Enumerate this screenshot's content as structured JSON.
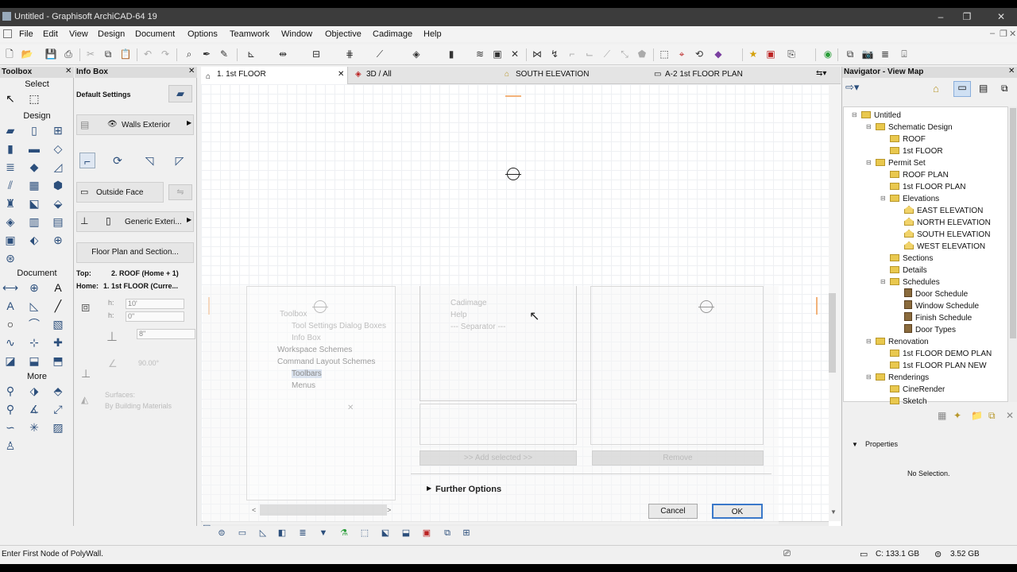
{
  "window": {
    "title": "Untitled - Graphisoft ArchiCAD-64 19"
  },
  "menu": [
    "File",
    "Edit",
    "View",
    "Design",
    "Document",
    "Options",
    "Teamwork",
    "Window",
    "Objective",
    "Cadimage",
    "Help"
  ],
  "toolbox": {
    "title": "Toolbox",
    "select_label": "Select",
    "design_label": "Design",
    "document_label": "Document",
    "more_label": "More"
  },
  "infobox": {
    "title": "Info Box",
    "default_settings": "Default Settings",
    "wall_type": "Walls Exterior",
    "reference_line": "Outside Face",
    "composite": "Generic Exteri...",
    "floor_plan_button": "Floor Plan and Section...",
    "top_label": "Top:",
    "top_value": "2. ROOF (Home + 1)",
    "home_label": "Home:",
    "home_value": "1. 1st FLOOR (Curre...",
    "height_label": "h:",
    "height_value": "10'",
    "offset_label": "h:",
    "offset_value": "0\"",
    "thickness_value": "8\"",
    "angle_value": "90.00°",
    "surfaces_label": "Surfaces:",
    "surfaces_value": "By Building Materials"
  },
  "tabs": [
    {
      "label": "1. 1st FLOOR"
    },
    {
      "label": "3D / All"
    },
    {
      "label": "SOUTH ELEVATION"
    },
    {
      "label": "A-2 1st FLOOR PLAN"
    }
  ],
  "dialog": {
    "tree_items": [
      "Toolbox",
      "Tool Settings Dialog Boxes",
      "Info Box",
      "Workspace Schemes",
      "Command Layout Schemes",
      "Toolbars",
      "Menus"
    ],
    "menu_items": [
      "Cadimage",
      "Help",
      "--- Separator ---"
    ],
    "add_button": ">> Add selected >>",
    "remove_button": "Remove",
    "further_options": "Further Options",
    "cancel": "Cancel",
    "ok": "OK"
  },
  "navigator": {
    "title": "Navigator - View Map",
    "tree": [
      {
        "label": "Untitled",
        "depth": 0,
        "icon": "project"
      },
      {
        "label": "Schematic Design",
        "depth": 1,
        "icon": "folder"
      },
      {
        "label": "ROOF",
        "depth": 2,
        "icon": "folder"
      },
      {
        "label": "1st FLOOR",
        "depth": 2,
        "icon": "folder"
      },
      {
        "label": "Permit Set",
        "depth": 1,
        "icon": "folder"
      },
      {
        "label": "ROOF PLAN",
        "depth": 2,
        "icon": "folder"
      },
      {
        "label": "1st FLOOR PLAN",
        "depth": 2,
        "icon": "folder"
      },
      {
        "label": "Elevations",
        "depth": 2,
        "icon": "folder"
      },
      {
        "label": "EAST ELEVATION",
        "depth": 3,
        "icon": "elev"
      },
      {
        "label": "NORTH ELEVATION",
        "depth": 3,
        "icon": "elev"
      },
      {
        "label": "SOUTH ELEVATION",
        "depth": 3,
        "icon": "elev"
      },
      {
        "label": "WEST ELEVATION",
        "depth": 3,
        "icon": "elev"
      },
      {
        "label": "Sections",
        "depth": 2,
        "icon": "folder"
      },
      {
        "label": "Details",
        "depth": 2,
        "icon": "folder"
      },
      {
        "label": "Schedules",
        "depth": 2,
        "icon": "folder"
      },
      {
        "label": "Door Schedule",
        "depth": 3,
        "icon": "sched"
      },
      {
        "label": "Window Schedule",
        "depth": 3,
        "icon": "sched"
      },
      {
        "label": "Finish Schedule",
        "depth": 3,
        "icon": "sched"
      },
      {
        "label": "Door Types",
        "depth": 3,
        "icon": "sched"
      },
      {
        "label": "Renovation",
        "depth": 1,
        "icon": "folder"
      },
      {
        "label": "1st FLOOR DEMO PLAN",
        "depth": 2,
        "icon": "folder"
      },
      {
        "label": "1st FLOOR PLAN NEW",
        "depth": 2,
        "icon": "folder"
      },
      {
        "label": "Renderings",
        "depth": 1,
        "icon": "folder"
      },
      {
        "label": "CineRender",
        "depth": 2,
        "icon": "folder"
      },
      {
        "label": "Sketch",
        "depth": 2,
        "icon": "folder"
      }
    ],
    "properties_label": "Properties",
    "no_selection": "No Selection."
  },
  "status": {
    "prompt": "Enter First Node of PolyWall.",
    "disk": "C: 133.1 GB",
    "memory": "3.52 GB"
  }
}
